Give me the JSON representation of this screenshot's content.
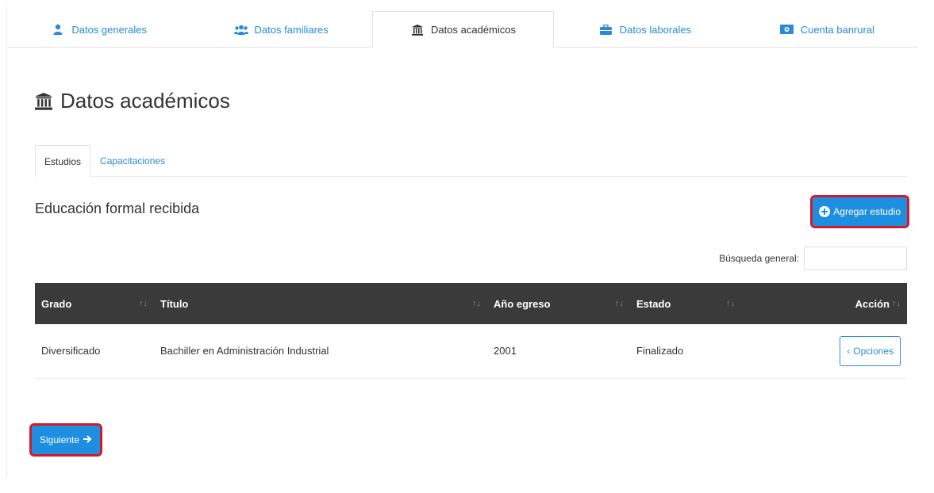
{
  "top_tabs": [
    {
      "label": "Datos generales",
      "icon": "user-icon"
    },
    {
      "label": "Datos familiares",
      "icon": "users-icon"
    },
    {
      "label": "Datos académicos",
      "icon": "institution-icon",
      "active": true
    },
    {
      "label": "Datos laborales",
      "icon": "briefcase-icon"
    },
    {
      "label": "Cuenta banrural",
      "icon": "money-icon"
    }
  ],
  "section": {
    "title": "Datos académicos",
    "icon": "institution-icon"
  },
  "inner_tabs": [
    {
      "label": "Estudios",
      "active": true
    },
    {
      "label": "Capacitaciones"
    }
  ],
  "subsection": {
    "title": "Educación formal recibida"
  },
  "actions": {
    "add_label": "Agregar estudio",
    "next_label": "Siguiente"
  },
  "search": {
    "label": "Búsqueda general:",
    "value": ""
  },
  "table": {
    "headers": [
      "Grado",
      "Título",
      "Año egreso",
      "Estado",
      "Acción"
    ],
    "rows": [
      {
        "grado": "Diversificado",
        "titulo": "Bachiller en Administración Industrial",
        "anio": "2001",
        "estado": "Finalizado",
        "accion": "Opciones"
      }
    ]
  },
  "colors": {
    "accent": "#1e8fe0",
    "header_bg": "#3a3a3a",
    "highlight": "#d11a2a"
  }
}
